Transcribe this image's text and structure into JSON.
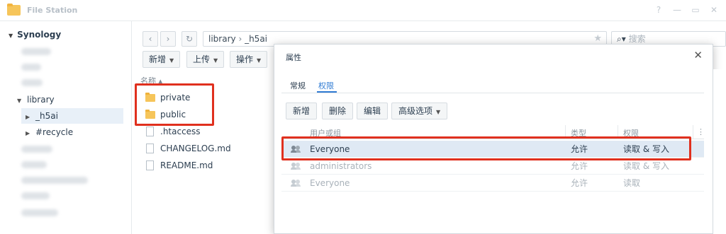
{
  "window": {
    "title": "File Station",
    "controls": [
      "?",
      "—",
      "▭",
      "✕"
    ]
  },
  "tree": {
    "root_label": "Synology",
    "nodes": [
      {
        "label": "library"
      },
      {
        "label": "_h5ai"
      },
      {
        "label": "#recycle"
      }
    ]
  },
  "toolbar": {
    "back": "‹",
    "forward": "›",
    "refresh": "↻",
    "path": [
      "library",
      "_h5ai"
    ],
    "path_sep": "›",
    "search_placeholder": "搜索",
    "buttons": [
      "新增",
      "上传",
      "操作"
    ]
  },
  "file_list": {
    "column_name": "名称 ▴",
    "files": [
      {
        "name": "private",
        "type": "folder"
      },
      {
        "name": "public",
        "type": "folder"
      },
      {
        "name": ".htaccess",
        "type": "file"
      },
      {
        "name": "CHANGELOG.md",
        "type": "file"
      },
      {
        "name": "README.md",
        "type": "file"
      }
    ]
  },
  "dialog": {
    "title": "属性",
    "close": "✕",
    "tabs": [
      "常规",
      "权限"
    ],
    "active_tab": "权限",
    "buttons": [
      "新增",
      "删除",
      "编辑",
      "高级选项"
    ],
    "columns": [
      "用户或组",
      "类型",
      "权限"
    ],
    "column_menu": "⋮",
    "rows": [
      {
        "user": "Everyone",
        "type": "允许",
        "perm": "读取 & 写入",
        "selected": true
      },
      {
        "user": "administrators",
        "type": "允许",
        "perm": "读取 & 写入",
        "selected": false
      },
      {
        "user": "Everyone",
        "type": "允许",
        "perm": "读取",
        "selected": false
      }
    ]
  },
  "colors": {
    "highlight": "#e0301e",
    "accent": "#2f7bd3",
    "folder": "#f6c55a"
  }
}
